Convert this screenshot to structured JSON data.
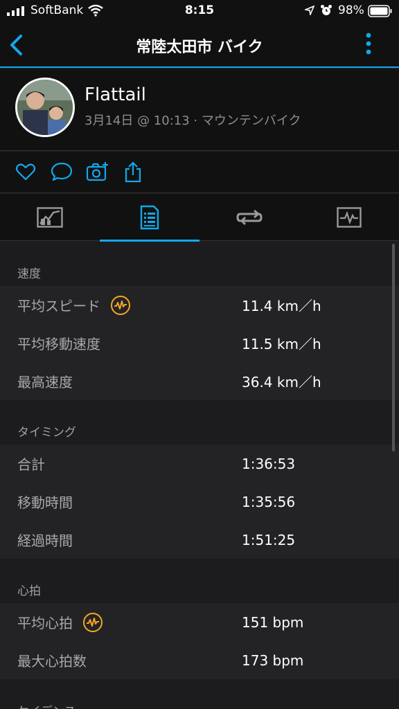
{
  "status": {
    "carrier": "SoftBank",
    "time": "8:15",
    "battery": "98%"
  },
  "nav": {
    "title": "常陸太田市 バイク",
    "back_icon": "chevron-left-icon",
    "more_icon": "vertical-ellipsis-icon"
  },
  "profile": {
    "name": "Flattail",
    "meta": "3月14日 @ 10:13 · マウンテンバイク"
  },
  "actions": [
    "heart-icon",
    "comment-icon",
    "camera-add-icon",
    "share-icon"
  ],
  "tabs": [
    {
      "icon": "map-chart-icon",
      "active": false
    },
    {
      "icon": "stats-list-icon",
      "active": true
    },
    {
      "icon": "laps-icon",
      "active": false
    },
    {
      "icon": "graph-icon",
      "active": false
    }
  ],
  "colors": {
    "accent": "#11a9ed",
    "badge": "#f5a623"
  },
  "sections": {
    "speed": {
      "title": "速度",
      "rows": [
        {
          "label": "平均スピード",
          "value": "11.4 km／h"
        },
        {
          "label": "平均移動速度",
          "value": "11.5 km／h"
        },
        {
          "label": "最高速度",
          "value": "36.4 km／h"
        }
      ]
    },
    "timing": {
      "title": "タイミング",
      "rows": [
        {
          "label": "合計",
          "value": "1:36:53"
        },
        {
          "label": "移動時間",
          "value": "1:35:56"
        },
        {
          "label": "経過時間",
          "value": "1:51:25"
        }
      ]
    },
    "heart": {
      "title": "心拍",
      "rows": [
        {
          "label": "平均心拍",
          "value": "151 bpm"
        },
        {
          "label": "最大心拍数",
          "value": "173 bpm"
        }
      ]
    },
    "cadence": {
      "title": "ケイデンス"
    }
  }
}
